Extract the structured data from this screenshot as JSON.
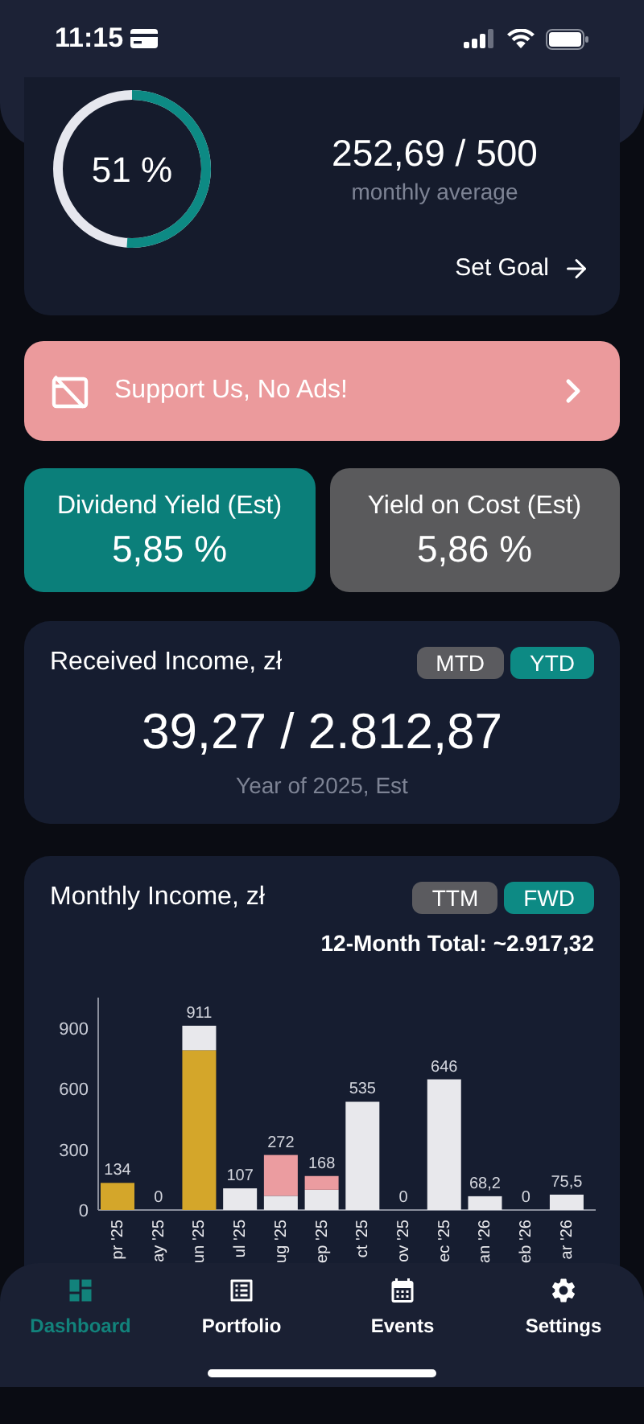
{
  "status_bar": {
    "time": "11:15"
  },
  "goal": {
    "percent": "51 %",
    "value": "252,69 / 500",
    "caption": "monthly average",
    "action": "Set Goal"
  },
  "banner": {
    "text": "Support Us, No Ads!"
  },
  "yields": [
    {
      "label": "Dividend Yield (Est)",
      "value": "5,85 %",
      "selected": true
    },
    {
      "label": "Yield on Cost (Est)",
      "value": "5,86 %",
      "selected": false
    }
  ],
  "received_income": {
    "title": "Received Income, zł",
    "toggles": [
      {
        "label": "MTD",
        "selected": false
      },
      {
        "label": "YTD",
        "selected": true
      }
    ],
    "value": "39,27 / 2.812,87",
    "caption": "Year of 2025, Est"
  },
  "monthly_income": {
    "title": "Monthly Income, zł",
    "toggles": [
      {
        "label": "TTM",
        "selected": false
      },
      {
        "label": "FWD",
        "selected": true
      }
    ],
    "total": "12-Month Total: ~2.917,32",
    "chart_data": {
      "type": "bar",
      "stacked": true,
      "categories": [
        "pr '25",
        "ay '25",
        "un '25",
        "ul '25",
        "ug '25",
        "ep '25",
        "ct '25",
        "ov '25",
        "ec '25",
        "an '26",
        "eb '26",
        "ar '26"
      ],
      "series": [
        {
          "color": "#d4a62a",
          "values": [
            134,
            0,
            790,
            0,
            0,
            0,
            0,
            0,
            0,
            0,
            0,
            0
          ]
        },
        {
          "color": "#e8e8ec",
          "values": [
            0,
            0,
            121,
            107,
            70,
            100,
            535,
            0,
            646,
            68,
            0,
            76
          ]
        },
        {
          "color": "#eb9ca0",
          "values": [
            0,
            0,
            0,
            0,
            202,
            68,
            0,
            0,
            0,
            0,
            0,
            0
          ]
        }
      ],
      "ylim": [
        0,
        1050
      ],
      "yticks": [
        0,
        300,
        600,
        900
      ],
      "value_labels": [
        "134",
        "0",
        "911",
        "107",
        "272",
        "168",
        "535",
        "0",
        "646",
        "68,2",
        "0",
        "75,5"
      ]
    }
  },
  "tab_bar": [
    {
      "label": "Dashboard",
      "selected": true
    },
    {
      "label": "Portfolio",
      "selected": false
    },
    {
      "label": "Events",
      "selected": false
    },
    {
      "label": "Settings",
      "selected": false
    }
  ]
}
